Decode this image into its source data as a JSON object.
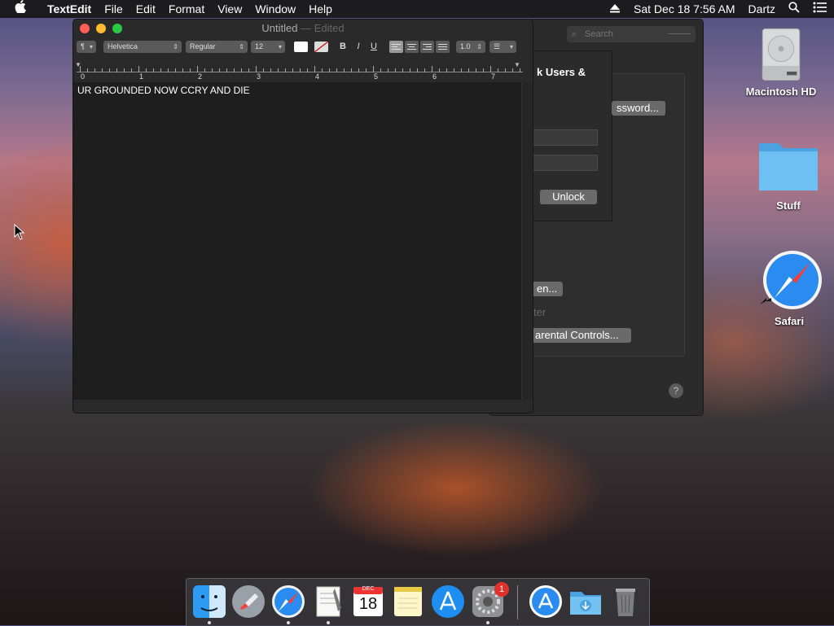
{
  "menubar": {
    "apple": "",
    "app_name": "TextEdit",
    "items": [
      "File",
      "Edit",
      "Format",
      "View",
      "Window",
      "Help"
    ],
    "clock": "Sat Dec 18  7:56 AM",
    "user": "Dartz"
  },
  "prefs_window": {
    "search_placeholder": "Search",
    "lock_title": "k Users &",
    "password_button": "ssword...",
    "unlock_button": "Unlock",
    "open_button": "en...",
    "gray_text": "ter",
    "parental_button": "arental Controls...",
    "help": "?"
  },
  "textedit": {
    "title": "Untitled",
    "title_suffix": " — Edited",
    "paragraph_style": "¶",
    "font": "Helvetica",
    "weight": "Regular",
    "size": "12",
    "bold": "B",
    "italic": "I",
    "underline": "U",
    "line_spacing": "1.0",
    "ruler_numbers": [
      "0",
      "1",
      "2",
      "3",
      "4",
      "5",
      "6",
      "7"
    ],
    "document_text": "UR GROUNDED NOW CCRY AND DIE"
  },
  "desktop": {
    "icons": [
      {
        "label": "Macintosh HD"
      },
      {
        "label": "Stuff"
      },
      {
        "label": "Safari"
      }
    ]
  },
  "dock": {
    "calendar_month": "DEC",
    "calendar_day": "18",
    "prefs_badge": "1"
  },
  "colors": {
    "close": "#ff5f57",
    "minimize": "#febc2e",
    "zoom": "#28c840",
    "badge": "#e0302c"
  }
}
